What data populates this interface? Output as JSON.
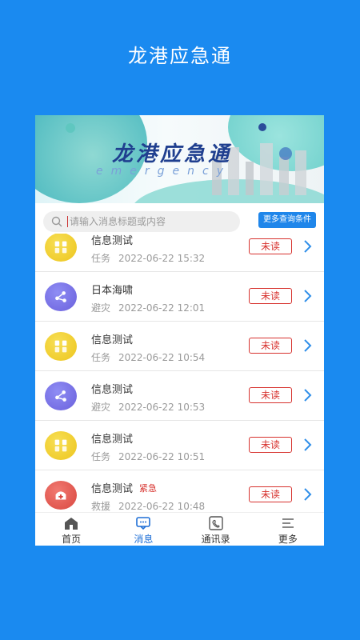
{
  "app": {
    "title": "龙港应急通"
  },
  "banner": {
    "logo_text": "龙港应急通",
    "sub_text": "emergency"
  },
  "search": {
    "placeholder": "请输入消息标题或内容",
    "more_label": "更多查询条件"
  },
  "messages": [
    {
      "title": "信息测试",
      "category": "任务",
      "time": "2022-06-22 15:32",
      "status": "未读",
      "urgent": "",
      "icon": "task-icon"
    },
    {
      "title": "日本海啸",
      "category": "避灾",
      "time": "2022-06-22 12:01",
      "status": "未读",
      "urgent": "",
      "icon": "avoid-disaster-icon"
    },
    {
      "title": "信息测试",
      "category": "任务",
      "time": "2022-06-22 10:54",
      "status": "未读",
      "urgent": "",
      "icon": "task-icon"
    },
    {
      "title": "信息测试",
      "category": "避灾",
      "time": "2022-06-22 10:53",
      "status": "未读",
      "urgent": "",
      "icon": "avoid-disaster-icon"
    },
    {
      "title": "信息测试",
      "category": "任务",
      "time": "2022-06-22 10:51",
      "status": "未读",
      "urgent": "",
      "icon": "task-icon"
    },
    {
      "title": "信息测试",
      "category": "救援",
      "time": "2022-06-22 10:48",
      "status": "未读",
      "urgent": "紧急",
      "icon": "rescue-icon"
    }
  ],
  "tabs": [
    {
      "label": "首页",
      "icon": "home-icon"
    },
    {
      "label": "消息",
      "icon": "message-icon"
    },
    {
      "label": "通讯录",
      "icon": "contacts-icon"
    },
    {
      "label": "更多",
      "icon": "menu-icon"
    }
  ],
  "colors": {
    "background": "#1a8af0",
    "accent": "#1f86ea",
    "unread": "#d7322e"
  }
}
